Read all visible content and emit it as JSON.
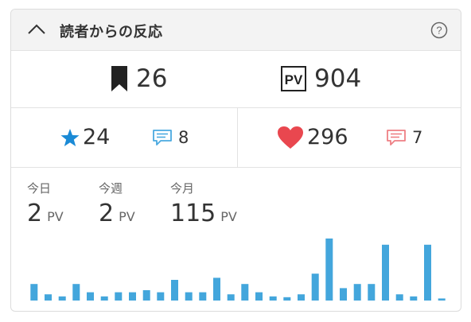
{
  "header": {
    "title": "読者からの反応",
    "collapse_icon": "chevron-up-icon",
    "help_icon": "question-circle-icon"
  },
  "stats": {
    "bookmarks": {
      "icon": "bookmark-icon",
      "value": "26"
    },
    "pv_total": {
      "icon": "pv-icon",
      "value": "904"
    },
    "stars": {
      "icon": "star-icon",
      "value": "24",
      "color": "#1a8ad6"
    },
    "star_comments": {
      "icon": "comment-icon",
      "value": "8",
      "color": "#4aa9e0"
    },
    "hearts": {
      "icon": "heart-icon",
      "value": "296",
      "color": "#e9474f"
    },
    "heart_comments": {
      "icon": "comment-icon",
      "value": "7",
      "color": "#ee7f84"
    }
  },
  "pageviews": {
    "today": {
      "label": "今日",
      "value": "2",
      "unit": "PV"
    },
    "week": {
      "label": "今週",
      "value": "2",
      "unit": "PV"
    },
    "month": {
      "label": "今月",
      "value": "115",
      "unit": "PV"
    }
  },
  "chart_data": {
    "type": "bar",
    "title": "",
    "xlabel": "",
    "ylabel": "",
    "grid": false,
    "color": "#43a6dc",
    "values": [
      4,
      1.5,
      1,
      4,
      2,
      1,
      2,
      2,
      2.5,
      2,
      5,
      2,
      2,
      5.5,
      1.5,
      4,
      2,
      1,
      0.8,
      1.5,
      6.5,
      15,
      3,
      4,
      4,
      13.5,
      1.5,
      1,
      13.5,
      0.5
    ],
    "ylim": [
      0,
      15
    ]
  }
}
